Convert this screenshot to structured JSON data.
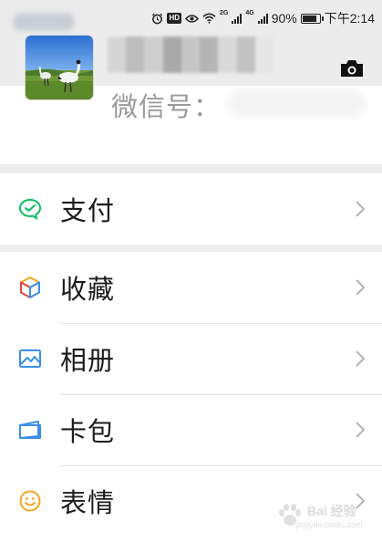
{
  "status_bar": {
    "battery_text": "90%",
    "battery_level": 0.9,
    "network_1": "2G",
    "network_2": "4G",
    "time": "下午2:14"
  },
  "profile": {
    "wechat_id_label": "微信号："
  },
  "menu": {
    "pay": {
      "label": "支付",
      "icon": "wechat-pay-icon",
      "color": "#07c160"
    },
    "favorites": {
      "label": "收藏",
      "icon": "cube-icon"
    },
    "album": {
      "label": "相册",
      "icon": "image-icon",
      "color": "#3a8ee6"
    },
    "cards": {
      "label": "卡包",
      "icon": "wallet-icon",
      "color": "#3a8ee6"
    },
    "stickers": {
      "label": "表情",
      "icon": "smiley-icon",
      "color": "#f5a623"
    }
  },
  "watermark": {
    "text": "Bai 经验",
    "sub": "jingyan.baidu.com"
  }
}
